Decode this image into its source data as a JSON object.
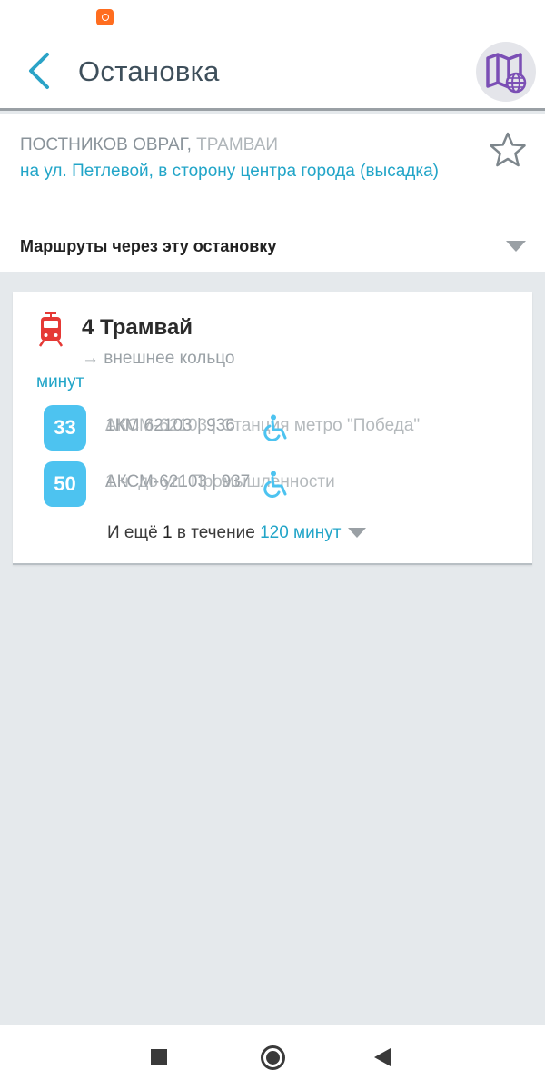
{
  "status_bar": {
    "notification_icon": "app-notification-icon"
  },
  "header": {
    "title": "Остановка",
    "back_icon": "chevron-left-icon",
    "map_icon": "map-globe-icon"
  },
  "stop": {
    "name": "ПОСТНИКОВ ОВРАГ",
    "separator": ", ",
    "transport_kind": "ТРАМВАИ",
    "direction": "на ул. Петлевой, в сторону центра города (высадка)",
    "favorite_icon": "star-outline-icon",
    "routes_header": "Маршруты через эту остановку",
    "routes_toggle_icon": "caret-down-icon"
  },
  "route_card": {
    "icon": "tram-icon",
    "title": "4 Трамвай",
    "direction": "→ внешнее кольцо",
    "minutes_label": "минут",
    "vehicles": [
      {
        "minutes": "33",
        "vehicle_info": "1КМ 62103 | 936",
        "destination": "АКСМ-62103 | Станция метро \"Победа\"",
        "accessibility_icon": "wheelchair-icon"
      },
      {
        "minutes": "50",
        "vehicle_info": "АКСМ-62103 | 937",
        "destination": "1 ч. до ул. Промышленности",
        "accessibility_icon": "wheelchair-icon"
      }
    ],
    "more": {
      "prefix": "И ещё ",
      "count": "1",
      "middle": " в течение ",
      "minutes": "120 минут"
    }
  },
  "colors": {
    "accent": "#22a5c8",
    "badge": "#4dc3f0",
    "tram_red": "#e53935",
    "map_purple": "#7b4fb5",
    "background": "#e5e9ec"
  },
  "nav_bar": {
    "recents_icon": "square-icon",
    "home_icon": "circle-home-icon",
    "back_icon": "triangle-back-icon"
  }
}
